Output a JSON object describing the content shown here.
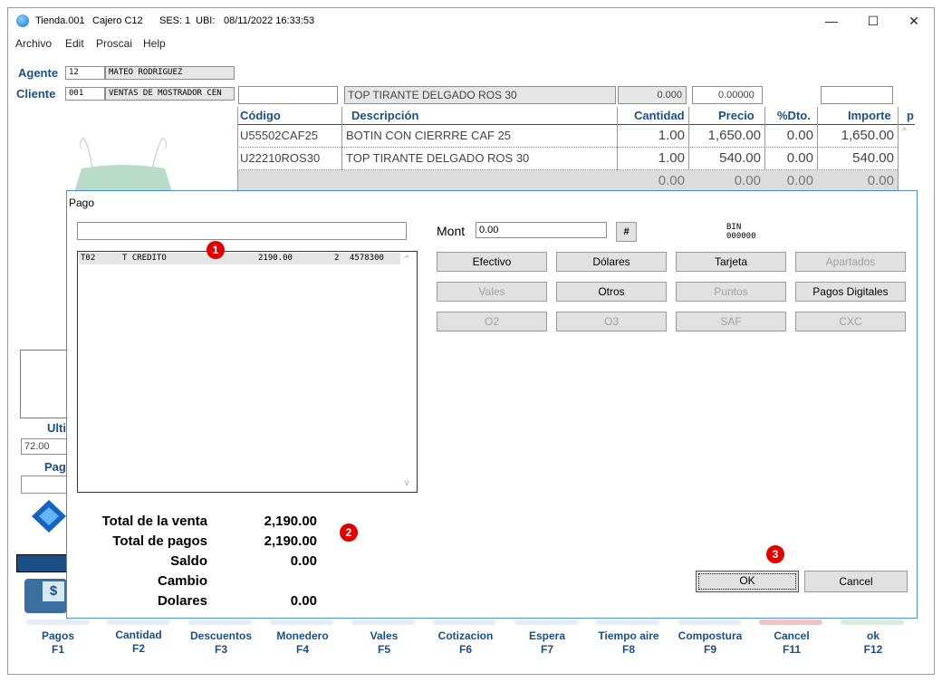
{
  "titlebar": {
    "store": "Tienda.001",
    "cashier": "Cajero C12",
    "session": "SES: 1",
    "ubi_label": "UBI:",
    "datetime": "08/11/2022 16:33:53",
    "minimize": "—",
    "maximize": "☐",
    "close": "✕"
  },
  "menu": [
    "Archivo",
    "Edit",
    "Proscai",
    "Help"
  ],
  "agent": {
    "label": "Agente",
    "code": "12",
    "name": "MATEO RODRIGUEZ"
  },
  "client": {
    "label": "Cliente",
    "code": "001",
    "name": "VENTAS DE MOSTRADOR CEN"
  },
  "item_entry": {
    "code": "",
    "description": "TOP TIRANTE DELGADO ROS 30",
    "qty": "0.000",
    "price": "0.00000",
    "extra": ""
  },
  "grid": {
    "headers": [
      "Código",
      "Descripción",
      "Cantidad",
      "Precio",
      "%Dto.",
      "Importe",
      "p"
    ],
    "rows": [
      [
        "U55502CAF25",
        "BOTIN  CON CIERRRE CAF 25",
        "1.00",
        "1,650.00",
        "0.00",
        "1,650.00"
      ],
      [
        "U22210ROS30",
        "TOP TIRANTE DELGADO ROS 30",
        "1.00",
        "540.00",
        "0.00",
        "540.00"
      ],
      [
        "",
        "",
        "0.00",
        "0.00",
        "0.00",
        "0.00"
      ]
    ]
  },
  "left_panel": {
    "ulti_label": "Ulti",
    "ulti_value": "72.00",
    "pag_label": "Pag",
    "cash_symbol": "$"
  },
  "dialog": {
    "title": "Pago",
    "search_value": "",
    "mont_label": "Mont",
    "mont_value": "0.00",
    "hash_button": "#",
    "bin_label": "BIN",
    "bin_value": "000000",
    "payments": [
      {
        "type": "T02",
        "name": "T CREDITO",
        "amount": "2190.00",
        "n": "2",
        "ref": "4578300"
      }
    ],
    "buttons_row1": [
      {
        "label": "Efectivo",
        "enabled": true
      },
      {
        "label": "Dólares",
        "enabled": true
      },
      {
        "label": "Tarjeta",
        "enabled": true
      },
      {
        "label": "Apartados",
        "enabled": false
      }
    ],
    "buttons_row2": [
      {
        "label": "Vales",
        "enabled": false
      },
      {
        "label": "Otros",
        "enabled": true
      },
      {
        "label": "Puntos",
        "enabled": false
      },
      {
        "label": "Pagos Digitales",
        "enabled": true
      }
    ],
    "buttons_row3": [
      {
        "label": "O2",
        "enabled": false
      },
      {
        "label": "O3",
        "enabled": false
      },
      {
        "label": "SAF",
        "enabled": false
      },
      {
        "label": "CXC",
        "enabled": false
      }
    ],
    "totals": [
      {
        "label": "Total de la venta",
        "value": "2,190.00"
      },
      {
        "label": "Total de pagos",
        "value": "2,190.00"
      },
      {
        "label": "Saldo",
        "value": "0.00"
      },
      {
        "label": "Cambio",
        "value": ""
      },
      {
        "label": "Dolares",
        "value": "0.00"
      }
    ],
    "ok_label": "OK",
    "cancel_label": "Cancel"
  },
  "badges": [
    "1",
    "2",
    "3"
  ],
  "fkeys": [
    {
      "label": "Pagos",
      "key": "F1"
    },
    {
      "label": "Cantidad",
      "key": "F2"
    },
    {
      "label": "Descuentos",
      "key": "F3"
    },
    {
      "label": "Monedero",
      "key": "F4"
    },
    {
      "label": "Vales",
      "key": "F5"
    },
    {
      "label": "Cotizacion",
      "key": "F6"
    },
    {
      "label": "Espera",
      "key": "F7"
    },
    {
      "label": "Tiempo aire",
      "key": "F8"
    },
    {
      "label": "Compostura",
      "key": "F9"
    },
    {
      "label": "Cancel",
      "key": "F11"
    },
    {
      "label": "ok",
      "key": "F12"
    }
  ],
  "colors": {
    "accent": "#1a4f86",
    "badge": "#e00000",
    "dialog_border": "#4a8fc9",
    "cancel_key": "#f2c4c4",
    "ok_key": "#d8eedc"
  }
}
